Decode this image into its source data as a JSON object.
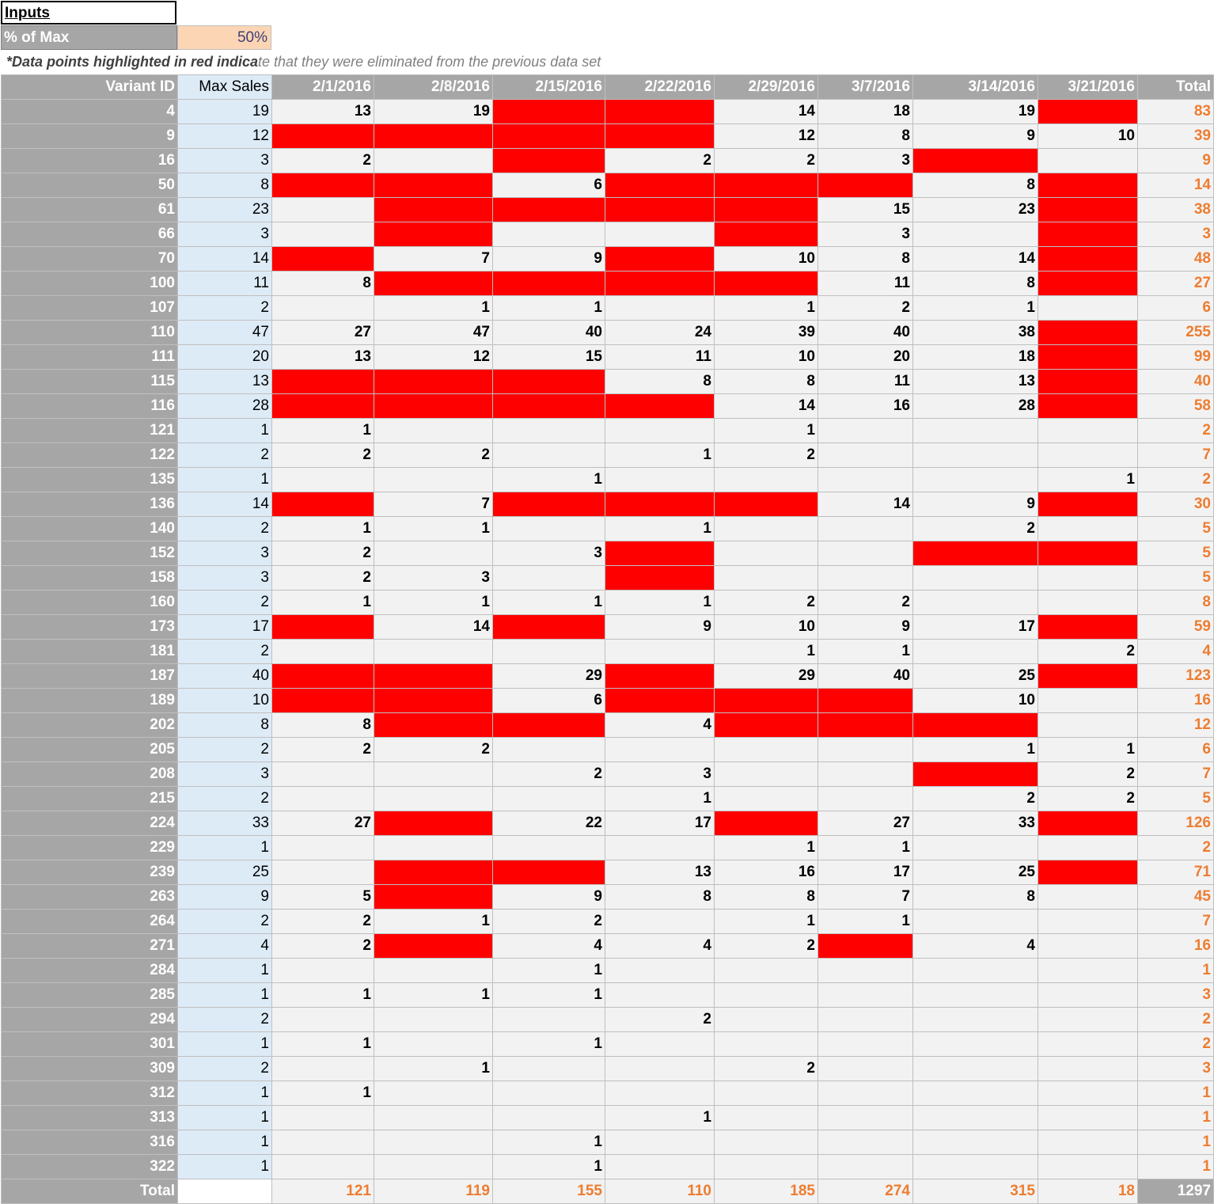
{
  "inputs": {
    "title": "Inputs",
    "pct_label": "% of Max",
    "pct_value": "50%"
  },
  "note": {
    "part1": "*Data points highlighted in red indica",
    "part2": "te that they were eliminated from the previous data set"
  },
  "headers": {
    "variant": "Variant ID",
    "max": "Max Sales",
    "total": "Total",
    "dates": [
      "2/1/2016",
      "2/8/2016",
      "2/15/2016",
      "2/22/2016",
      "2/29/2016",
      "3/7/2016",
      "3/14/2016",
      "3/21/2016"
    ]
  },
  "rows": [
    {
      "id": "4",
      "max": "19",
      "cells": [
        "13",
        "19",
        "R",
        "R",
        "14",
        "18",
        "19",
        "R"
      ],
      "total": "83"
    },
    {
      "id": "9",
      "max": "12",
      "cells": [
        "R",
        "R",
        "R",
        "R",
        "12",
        "8",
        "9",
        "10"
      ],
      "total": "39"
    },
    {
      "id": "16",
      "max": "3",
      "cells": [
        "2",
        "",
        "R",
        "2",
        "2",
        "3",
        "R",
        ""
      ],
      "total": "9"
    },
    {
      "id": "50",
      "max": "8",
      "cells": [
        "R",
        "R",
        "6",
        "R",
        "R",
        "R",
        "8",
        "R"
      ],
      "total": "14"
    },
    {
      "id": "61",
      "max": "23",
      "cells": [
        "",
        "R",
        "R",
        "R",
        "R",
        "15",
        "23",
        "R"
      ],
      "total": "38"
    },
    {
      "id": "66",
      "max": "3",
      "cells": [
        "",
        "R",
        "",
        "",
        "R",
        "3",
        "",
        "R"
      ],
      "total": "3"
    },
    {
      "id": "70",
      "max": "14",
      "cells": [
        "R",
        "7",
        "9",
        "R",
        "10",
        "8",
        "14",
        "R"
      ],
      "total": "48"
    },
    {
      "id": "100",
      "max": "11",
      "cells": [
        "8",
        "R",
        "R",
        "R",
        "R",
        "11",
        "8",
        "R"
      ],
      "total": "27"
    },
    {
      "id": "107",
      "max": "2",
      "cells": [
        "",
        "1",
        "1",
        "",
        "1",
        "2",
        "1",
        ""
      ],
      "total": "6"
    },
    {
      "id": "110",
      "max": "47",
      "cells": [
        "27",
        "47",
        "40",
        "24",
        "39",
        "40",
        "38",
        "R"
      ],
      "total": "255"
    },
    {
      "id": "111",
      "max": "20",
      "cells": [
        "13",
        "12",
        "15",
        "11",
        "10",
        "20",
        "18",
        "R"
      ],
      "total": "99"
    },
    {
      "id": "115",
      "max": "13",
      "cells": [
        "R",
        "R",
        "R",
        "8",
        "8",
        "11",
        "13",
        "R"
      ],
      "total": "40"
    },
    {
      "id": "116",
      "max": "28",
      "cells": [
        "R",
        "R",
        "R",
        "R",
        "14",
        "16",
        "28",
        "R"
      ],
      "total": "58"
    },
    {
      "id": "121",
      "max": "1",
      "cells": [
        "1",
        "",
        "",
        "",
        "1",
        "",
        "",
        ""
      ],
      "total": "2"
    },
    {
      "id": "122",
      "max": "2",
      "cells": [
        "2",
        "2",
        "",
        "1",
        "2",
        "",
        "",
        ""
      ],
      "total": "7"
    },
    {
      "id": "135",
      "max": "1",
      "cells": [
        "",
        "",
        "1",
        "",
        "",
        "",
        "",
        "1"
      ],
      "total": "2"
    },
    {
      "id": "136",
      "max": "14",
      "cells": [
        "R",
        "7",
        "R",
        "R",
        "R",
        "14",
        "9",
        "R"
      ],
      "total": "30"
    },
    {
      "id": "140",
      "max": "2",
      "cells": [
        "1",
        "1",
        "",
        "1",
        "",
        "",
        "2",
        ""
      ],
      "total": "5"
    },
    {
      "id": "152",
      "max": "3",
      "cells": [
        "2",
        "",
        "3",
        "R",
        "",
        "",
        "R",
        "R"
      ],
      "total": "5"
    },
    {
      "id": "158",
      "max": "3",
      "cells": [
        "2",
        "3",
        "",
        "R",
        "",
        "",
        "",
        ""
      ],
      "total": "5"
    },
    {
      "id": "160",
      "max": "2",
      "cells": [
        "1",
        "1",
        "1",
        "1",
        "2",
        "2",
        "",
        ""
      ],
      "total": "8"
    },
    {
      "id": "173",
      "max": "17",
      "cells": [
        "R",
        "14",
        "R",
        "9",
        "10",
        "9",
        "17",
        "R"
      ],
      "total": "59"
    },
    {
      "id": "181",
      "max": "2",
      "cells": [
        "",
        "",
        "",
        "",
        "1",
        "1",
        "",
        "2"
      ],
      "total": "4"
    },
    {
      "id": "187",
      "max": "40",
      "cells": [
        "R",
        "R",
        "29",
        "R",
        "29",
        "40",
        "25",
        "R"
      ],
      "total": "123"
    },
    {
      "id": "189",
      "max": "10",
      "cells": [
        "R",
        "R",
        "6",
        "R",
        "R",
        "R",
        "10",
        ""
      ],
      "total": "16"
    },
    {
      "id": "202",
      "max": "8",
      "cells": [
        "8",
        "R",
        "R",
        "4",
        "R",
        "R",
        "R",
        ""
      ],
      "total": "12"
    },
    {
      "id": "205",
      "max": "2",
      "cells": [
        "2",
        "2",
        "",
        "",
        "",
        "",
        "1",
        "1"
      ],
      "total": "6"
    },
    {
      "id": "208",
      "max": "3",
      "cells": [
        "",
        "",
        "2",
        "3",
        "",
        "",
        "R",
        "2"
      ],
      "total": "7"
    },
    {
      "id": "215",
      "max": "2",
      "cells": [
        "",
        "",
        "",
        "1",
        "",
        "",
        "2",
        "2"
      ],
      "total": "5"
    },
    {
      "id": "224",
      "max": "33",
      "cells": [
        "27",
        "R",
        "22",
        "17",
        "R",
        "27",
        "33",
        "R"
      ],
      "total": "126"
    },
    {
      "id": "229",
      "max": "1",
      "cells": [
        "",
        "",
        "",
        "",
        "1",
        "1",
        "",
        ""
      ],
      "total": "2"
    },
    {
      "id": "239",
      "max": "25",
      "cells": [
        "",
        "R",
        "R",
        "13",
        "16",
        "17",
        "25",
        "R"
      ],
      "total": "71"
    },
    {
      "id": "263",
      "max": "9",
      "cells": [
        "5",
        "R",
        "9",
        "8",
        "8",
        "7",
        "8",
        ""
      ],
      "total": "45"
    },
    {
      "id": "264",
      "max": "2",
      "cells": [
        "2",
        "1",
        "2",
        "",
        "1",
        "1",
        "",
        ""
      ],
      "total": "7"
    },
    {
      "id": "271",
      "max": "4",
      "cells": [
        "2",
        "R",
        "4",
        "4",
        "2",
        "R",
        "4",
        ""
      ],
      "total": "16"
    },
    {
      "id": "284",
      "max": "1",
      "cells": [
        "",
        "",
        "1",
        "",
        "",
        "",
        "",
        ""
      ],
      "total": "1"
    },
    {
      "id": "285",
      "max": "1",
      "cells": [
        "1",
        "1",
        "1",
        "",
        "",
        "",
        "",
        ""
      ],
      "total": "3"
    },
    {
      "id": "294",
      "max": "2",
      "cells": [
        "",
        "",
        "",
        "2",
        "",
        "",
        "",
        ""
      ],
      "total": "2"
    },
    {
      "id": "301",
      "max": "1",
      "cells": [
        "1",
        "",
        "1",
        "",
        "",
        "",
        "",
        ""
      ],
      "total": "2"
    },
    {
      "id": "309",
      "max": "2",
      "cells": [
        "",
        "1",
        "",
        "",
        "2",
        "",
        "",
        ""
      ],
      "total": "3"
    },
    {
      "id": "312",
      "max": "1",
      "cells": [
        "1",
        "",
        "",
        "",
        "",
        "",
        "",
        ""
      ],
      "total": "1"
    },
    {
      "id": "313",
      "max": "1",
      "cells": [
        "",
        "",
        "",
        "1",
        "",
        "",
        "",
        ""
      ],
      "total": "1"
    },
    {
      "id": "316",
      "max": "1",
      "cells": [
        "",
        "",
        "1",
        "",
        "",
        "",
        "",
        ""
      ],
      "total": "1"
    },
    {
      "id": "322",
      "max": "1",
      "cells": [
        "",
        "",
        "1",
        "",
        "",
        "",
        "",
        ""
      ],
      "total": "1"
    }
  ],
  "footer": {
    "label": "Total",
    "totals": [
      "121",
      "119",
      "155",
      "110",
      "185",
      "274",
      "315",
      "18"
    ],
    "grand": "1297"
  },
  "colors": {
    "red": "#ff0000",
    "header_gray": "#a6a6a6",
    "input_orange": "#fcd5b4",
    "max_blue": "#ddebf7",
    "total_orange": "#ed7d31"
  }
}
